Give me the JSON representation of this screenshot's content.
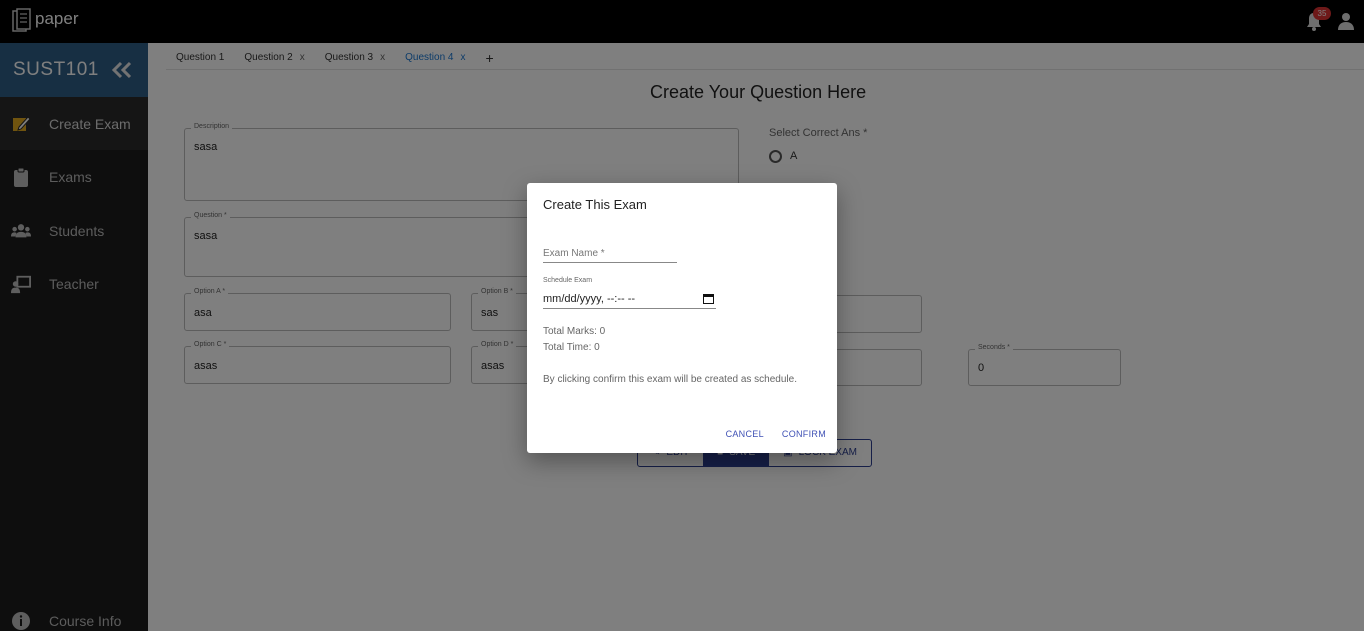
{
  "header": {
    "app_name": "paper",
    "notification_count": "35"
  },
  "sidebar": {
    "course_code": "SUST101",
    "items": [
      {
        "label": "Create Exam",
        "icon": "edit-note-icon",
        "active": true
      },
      {
        "label": "Exams",
        "icon": "clipboard-icon"
      },
      {
        "label": "Students",
        "icon": "people-icon"
      },
      {
        "label": "Teacher",
        "icon": "teacher-board-icon"
      }
    ],
    "footer_item": {
      "label": "Course Info",
      "icon": "info-icon"
    }
  },
  "tabs": [
    {
      "label": "Question 1"
    },
    {
      "label": "Question 2",
      "close": "x"
    },
    {
      "label": "Question 3",
      "close": "x"
    },
    {
      "label": "Question 4",
      "close": "x",
      "active": true
    }
  ],
  "tab_add": "+",
  "form": {
    "title": "Create Your Question Here",
    "description": {
      "label": "Description",
      "value": "sasa"
    },
    "question": {
      "label": "Question *",
      "value": "sasa"
    },
    "option_a": {
      "label": "Option A *",
      "value": "asa"
    },
    "option_b": {
      "label": "Option B *",
      "value": "sas"
    },
    "option_c": {
      "label": "Option C *",
      "value": "asas"
    },
    "option_d": {
      "label": "Option D *",
      "value": "asas"
    },
    "seconds": {
      "label": "Seconds *",
      "value": "0"
    },
    "correct_ans_label": "Select Correct Ans *",
    "correct_ans_option": "A",
    "buttons": {
      "edit": "EDIT",
      "save": "SAVE",
      "lock": "LOCK EXAM"
    }
  },
  "dialog": {
    "title": "Create This Exam",
    "exam_name_placeholder": "Exam Name *",
    "schedule_label": "Schedule Exam",
    "schedule_value": "mm/dd/yyyy, --:-- --",
    "total_marks": "Total Marks: 0",
    "total_time": "Total Time: 0",
    "notice": "By clicking confirm this exam will be created as schedule.",
    "cancel_label": "CANCEL",
    "confirm_label": "CONFIRM"
  },
  "colors": {
    "topbar": "#000000",
    "sidebar": "#1c1c1c",
    "course_header": "#2f5f86",
    "accent": "#3f51b5",
    "active_tab": "#1976d2",
    "badge": "#dd3333"
  }
}
